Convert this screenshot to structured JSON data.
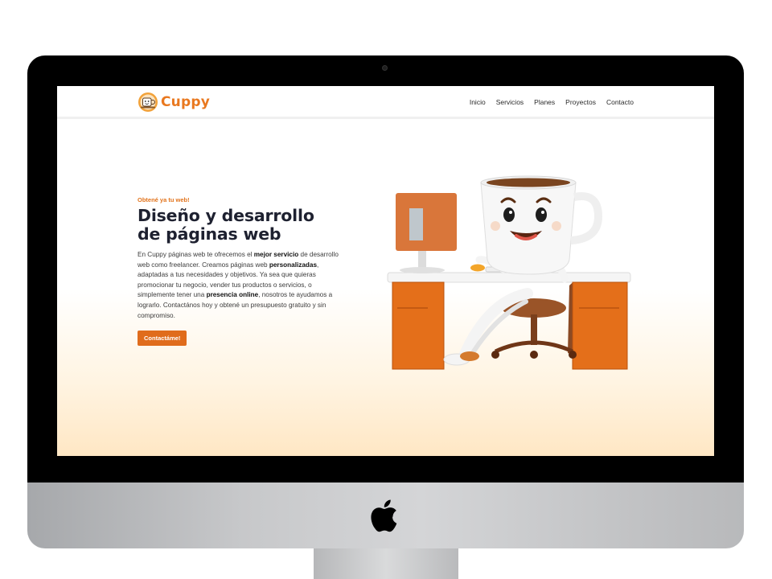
{
  "site": {
    "brand_name": "Cuppy",
    "nav": [
      "Inicio",
      "Servicios",
      "Planes",
      "Proyectos",
      "Contacto"
    ]
  },
  "hero": {
    "eyebrow": "Obtené ya tu web!",
    "title_line1": "Diseño y desarrollo",
    "title_line2": "de páginas web",
    "desc": {
      "p1": "En Cuppy páginas web te ofrecemos el ",
      "b1": "mejor servicio",
      "p2": " de desarrollo web como freelancer. Creamos páginas web ",
      "b2": "personalizadas",
      "p3": ", adaptadas a tus necesidades y objetivos. Ya sea que quieras promocionar tu negocio, vender tus productos o servicios, o simplemente tener una ",
      "b3": "presencia online",
      "p4": ", nosotros te ayudamos a lograrlo. Contactános hoy y obtené un presupuesto gratuito y sin compromiso."
    },
    "cta_label": "Contactáme!"
  },
  "colors": {
    "accent": "#e9781f",
    "button": "#e06c1c",
    "title": "#1e2130",
    "bezel": "#000000"
  },
  "icons": {
    "brand": "cuppy-logo-icon",
    "device": "apple-logo-icon",
    "hero": "coffee-cup-mascot-illustration"
  }
}
